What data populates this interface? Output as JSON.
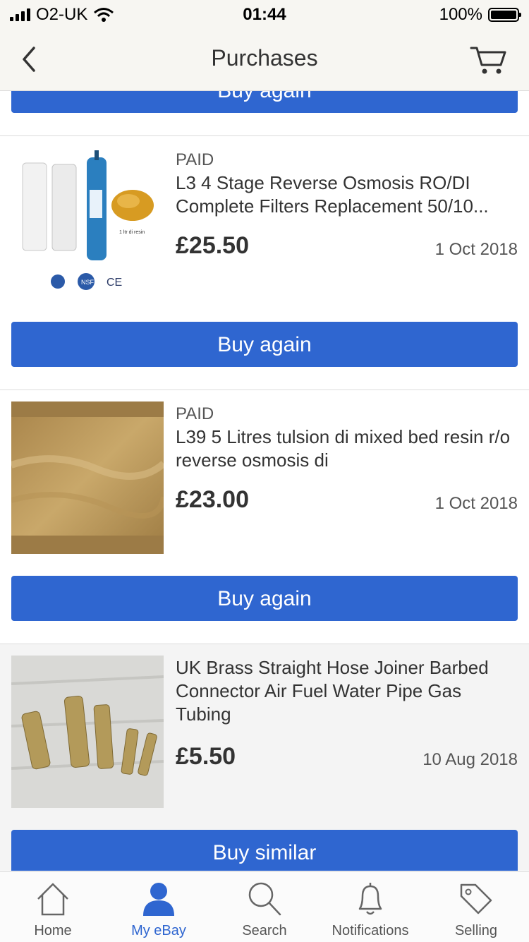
{
  "status_bar": {
    "carrier": "O2-UK",
    "time": "01:44",
    "battery": "100%"
  },
  "nav": {
    "title": "Purchases",
    "back_icon": "chevron-left-icon",
    "cart_icon": "cart-icon"
  },
  "top_button": {
    "label": "Buy again"
  },
  "items": [
    {
      "status": "PAID",
      "title": "L3 4 Stage Reverse Osmosis RO/DI Complete Filters Replacement 50/10...",
      "price": "£25.50",
      "date": "1 Oct 2018",
      "image_label": "1 ltr di resin",
      "button": "Buy again"
    },
    {
      "status": "PAID",
      "title": "L39  5 Litres tulsion di mixed bed resin r/o reverse osmosis di",
      "price": "£23.00",
      "date": "1 Oct 2018",
      "button": "Buy again"
    },
    {
      "status": "",
      "title": "UK Brass Straight Hose Joiner Barbed Connector Air Fuel Water Pipe Gas Tubing",
      "price": "£5.50",
      "date": "10 Aug 2018",
      "button": "Buy similar"
    }
  ],
  "tabs": [
    {
      "label": "Home",
      "icon": "home-icon",
      "active": false
    },
    {
      "label": "My eBay",
      "icon": "user-icon",
      "active": true
    },
    {
      "label": "Search",
      "icon": "search-icon",
      "active": false
    },
    {
      "label": "Notifications",
      "icon": "bell-icon",
      "active": false
    },
    {
      "label": "Selling",
      "icon": "tag-icon",
      "active": false
    }
  ],
  "colors": {
    "accent": "#2f66d0",
    "bar_background": "#f7f6f2"
  }
}
